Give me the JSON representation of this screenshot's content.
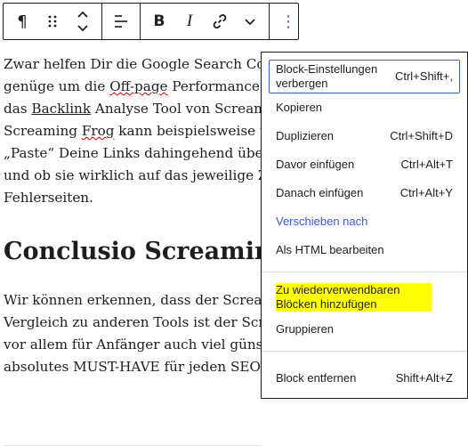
{
  "toolbar": {
    "buttons": [
      {
        "name": "paragraph-icon",
        "glyph": "¶"
      },
      {
        "name": "drag-handle-icon"
      },
      {
        "name": "move-up-down-icon"
      },
      {
        "name": "align-icon"
      },
      {
        "name": "bold-button",
        "glyph": "B"
      },
      {
        "name": "italic-button",
        "glyph": "I"
      },
      {
        "name": "link-icon"
      },
      {
        "name": "more-formatting-chevron-icon"
      },
      {
        "name": "options-kebab-icon",
        "glyph": "⋮"
      }
    ],
    "bold_label": "B",
    "italic_label": "I",
    "paragraph_glyph": "¶",
    "kebab_glyph": "⋮"
  },
  "article": {
    "p1": {
      "line1": "Zwar helfen Dir die Google Search Console",
      "line2a": "genüge um die ",
      "line2b": "Off-page",
      "line2c": " Performance Deir",
      "line3a": "das ",
      "line3b": "Backlink",
      "line3c": " Analyse Tool von Screaming",
      "line4a": "Screaming ",
      "line4b": "Frog",
      "line4c": " kann beispielsweise unter",
      "line5": "„Paste“ Deine Links dahingehend überprü",
      "line6": "und ob sie wirklich auf das jeweilige Ziel-S",
      "line7": "Fehlerseiten."
    },
    "heading": "Conclusio Screaming",
    "p2": {
      "line1": "Wir können erkennen, dass der Screaming",
      "line2": "Vergleich zu anderen Tools ist der Scream",
      "line3": "vor allem für Anfänger auch viel günstiger",
      "line4": "absolutes MUST-HAVE für jeden SEO."
    }
  },
  "menu": {
    "group1": [
      {
        "label": "Block-Einstellungen verbergen",
        "shortcut": "Ctrl+Shift+,"
      },
      {
        "label": "Kopieren",
        "shortcut": ""
      },
      {
        "label": "Duplizieren",
        "shortcut": "Ctrl+Shift+D"
      },
      {
        "label": "Davor einfügen",
        "shortcut": "Ctrl+Alt+T"
      },
      {
        "label": "Danach einfügen",
        "shortcut": "Ctrl+Alt+Y"
      },
      {
        "label": "Verschieben nach",
        "shortcut": ""
      },
      {
        "label": "Als HTML bearbeiten",
        "shortcut": ""
      }
    ],
    "group2": [
      {
        "label": "Zu wiederverwendbaren Blöcken hinzufügen",
        "shortcut": ""
      },
      {
        "label": "Gruppieren",
        "shortcut": ""
      }
    ],
    "group3": [
      {
        "label": "Block entfernen",
        "shortcut": "Shift+Alt+Z"
      }
    ]
  },
  "colors": {
    "accent": "#3858e9",
    "highlight": "#ffff00",
    "text": "#1e1e1e",
    "spellcheck": "#cc0000"
  }
}
